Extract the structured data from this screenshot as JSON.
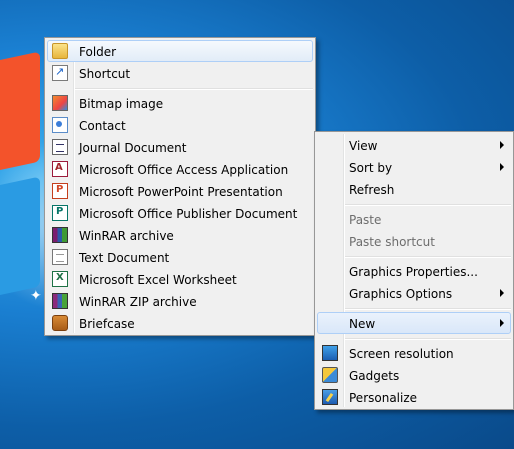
{
  "new_submenu": {
    "items": [
      {
        "label": "Folder",
        "icon": "folder-icon"
      },
      {
        "label": "Shortcut",
        "icon": "shortcut-icon"
      },
      {
        "label": "Bitmap image",
        "icon": "bitmap-icon"
      },
      {
        "label": "Contact",
        "icon": "contact-icon"
      },
      {
        "label": "Journal Document",
        "icon": "journal-icon"
      },
      {
        "label": "Microsoft Office Access Application",
        "icon": "access-icon"
      },
      {
        "label": "Microsoft PowerPoint Presentation",
        "icon": "powerpoint-icon"
      },
      {
        "label": "Microsoft Office Publisher Document",
        "icon": "publisher-icon"
      },
      {
        "label": "WinRAR archive",
        "icon": "winrar-icon"
      },
      {
        "label": "Text Document",
        "icon": "text-document-icon"
      },
      {
        "label": "Microsoft Excel Worksheet",
        "icon": "excel-icon"
      },
      {
        "label": "WinRAR ZIP archive",
        "icon": "winrar-zip-icon"
      },
      {
        "label": "Briefcase",
        "icon": "briefcase-icon"
      }
    ]
  },
  "context_menu": {
    "items": [
      {
        "label": "View",
        "submenu": true
      },
      {
        "label": "Sort by",
        "submenu": true
      },
      {
        "label": "Refresh"
      },
      {
        "label": "Paste",
        "disabled": true
      },
      {
        "label": "Paste shortcut",
        "disabled": true
      },
      {
        "label": "Graphics Properties..."
      },
      {
        "label": "Graphics Options",
        "submenu": true
      },
      {
        "label": "New",
        "submenu": true,
        "highlighted": true
      },
      {
        "label": "Screen resolution",
        "icon": "screen-resolution-icon"
      },
      {
        "label": "Gadgets",
        "icon": "gadgets-icon"
      },
      {
        "label": "Personalize",
        "icon": "personalize-icon"
      }
    ]
  },
  "colors": {
    "menu_background": "#f0f0f0",
    "highlight_border": "#aecff7",
    "disabled_text": "#6d6d6d"
  }
}
